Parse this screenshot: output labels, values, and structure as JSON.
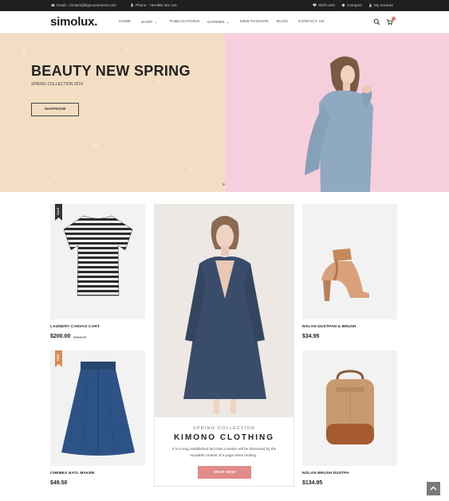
{
  "topbar": {
    "email": "Email : contact@bigecommerce.com",
    "phone": "Phone : +84-985 422 141",
    "wishlist": "Wish Lists",
    "compare": "Compare",
    "account": "My Account"
  },
  "header": {
    "logo": "simolux.",
    "nav": [
      "HOME",
      "SHOP",
      "PUBLICATIONS",
      "GARDEN",
      "NEW FASHION",
      "BLOG",
      "CONTACT US"
    ]
  },
  "hero": {
    "title": "BEAUTY NEW SPRING",
    "subtitle": "SPRING COLLECTION 2019",
    "button": "SHOPNOW"
  },
  "products": [
    {
      "name": "LAUNDRY CANVAS CART",
      "price": "$200.00",
      "old_price": "$210.00",
      "badge": "SALE",
      "badge_color": "#333333"
    },
    {
      "name": "NOLAN DUSTPAN & BRUSH",
      "price": "$34.95"
    },
    {
      "name": "CHEMEX NATL MAKER",
      "price": "$49.50",
      "badge": "NEW",
      "badge_color": "#d88b54"
    },
    {
      "name": "NOLAN BRUSH DUSTPA",
      "price": "$134.95"
    }
  ],
  "feature": {
    "kicker": "SPRING COLLECTION",
    "title": "KIMONO CLOTHING",
    "description": "It is a long established fact that a reader will be distracted by the readable content of a page when looking .",
    "button": "SHOP NOW"
  },
  "colors": {
    "accent": "#e18b8b",
    "topbar": "#1f1f1f",
    "hero_left": "#f4dec3",
    "hero_right": "#f7cfdc"
  },
  "icons": [
    "email-icon",
    "phone-icon",
    "heart-icon",
    "compare-icon",
    "user-icon",
    "search-icon",
    "cart-icon",
    "arrow-up-icon"
  ]
}
